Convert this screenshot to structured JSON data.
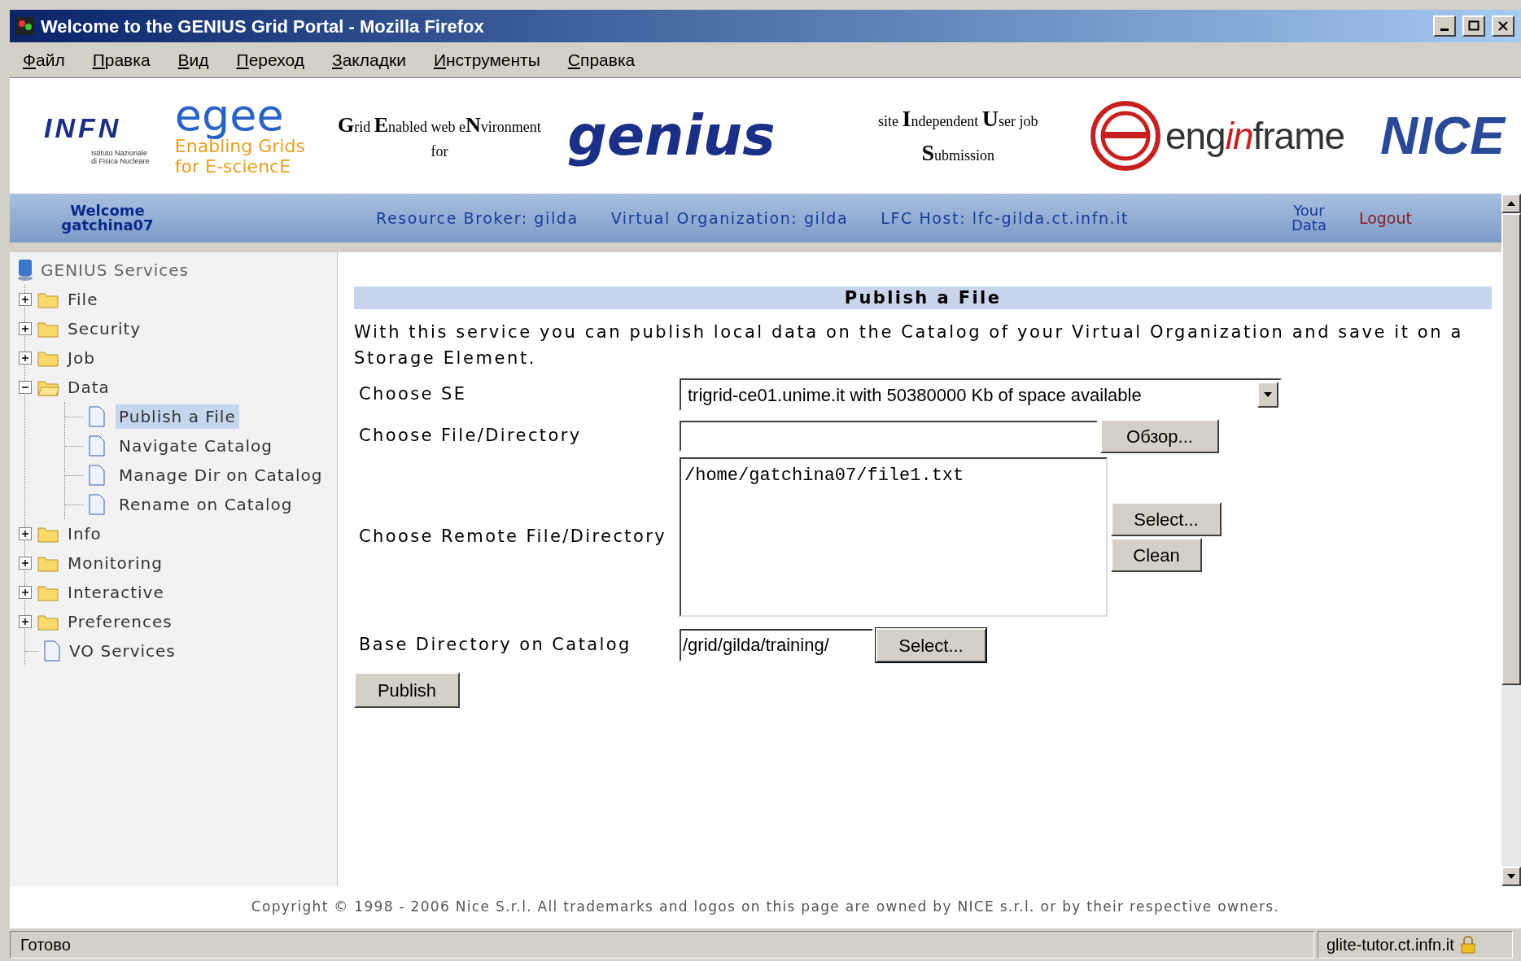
{
  "window": {
    "title": "Welcome to the GENIUS Grid Portal - Mozilla Firefox"
  },
  "menu": [
    "Файл",
    "Правка",
    "Вид",
    "Переход",
    "Закладки",
    "Инструменты",
    "Справка"
  ],
  "banner": {
    "infn": {
      "name": "INFN",
      "subtitle": [
        "Istituto Nazionale",
        "di Fisica Nucleare"
      ]
    },
    "egee": {
      "name": "egee",
      "tagline": [
        "Enabling Grids",
        "for E-sciencE"
      ]
    },
    "acronym_left": [
      "**G**rid **E**nabled web e**N**vironment",
      "for"
    ],
    "genius": "genius",
    "acronym_right": [
      "site **I**ndependent **U**ser job",
      "**S**ubmission"
    ],
    "enginframe": [
      "eng",
      "in",
      "frame"
    ],
    "nice": "NICE"
  },
  "nav": {
    "welcome": [
      "Welcome",
      "gatchina07"
    ],
    "items": [
      "Resource Broker: gilda",
      "Virtual Organization: gilda",
      "LFC Host: lfc-gilda.ct.infn.it"
    ],
    "your_data": [
      "Your",
      "Data"
    ],
    "logout": "Logout"
  },
  "sidebar": {
    "root": "GENIUS Services",
    "items": [
      {
        "label": "File",
        "kind": "folder",
        "expanded": false
      },
      {
        "label": "Security",
        "kind": "folder",
        "expanded": false
      },
      {
        "label": "Job",
        "kind": "folder",
        "expanded": false
      },
      {
        "label": "Data",
        "kind": "folder",
        "expanded": true,
        "children": [
          {
            "label": "Publish a File",
            "kind": "page",
            "selected": true
          },
          {
            "label": "Navigate Catalog",
            "kind": "page",
            "selected": false
          },
          {
            "label": "Manage Dir on Catalog",
            "kind": "page",
            "selected": false
          },
          {
            "label": "Rename on Catalog",
            "kind": "page",
            "selected": false
          }
        ]
      },
      {
        "label": "Info",
        "kind": "folder",
        "expanded": false
      },
      {
        "label": "Monitoring",
        "kind": "folder",
        "expanded": false
      },
      {
        "label": "Interactive",
        "kind": "folder",
        "expanded": false
      },
      {
        "label": "Preferences",
        "kind": "folder",
        "expanded": false
      },
      {
        "label": "VO Services",
        "kind": "page",
        "selected": false
      }
    ]
  },
  "form": {
    "heading": "Publish a File",
    "intro": "With this service you can publish local data on the Catalog of your Virtual Organization and save it on a Storage Element.",
    "fields": [
      {
        "kind": "select",
        "label": "Choose SE",
        "value": "trigrid-ce01.unime.it with 50380000 Kb of space available"
      },
      {
        "kind": "file",
        "label": "Choose File/Directory",
        "button": "Обзор..."
      },
      {
        "kind": "textarea",
        "label": "Choose Remote File/Directory",
        "value": "/home/gatchina07/file1.txt",
        "buttons": [
          "Select...",
          "Clean"
        ]
      },
      {
        "kind": "text",
        "label": "Base Directory on Catalog",
        "value": "/grid/gilda/training/",
        "button": "Select..."
      }
    ],
    "submit": "Publish"
  },
  "footer": "Copyright © 1998 - 2006 Nice S.r.l. All trademarks and logos on this page are owned by NICE s.r.l. or by their respective owners.",
  "status_bar": {
    "text": "Готово",
    "host": "glite-tutor.ct.infn.it"
  }
}
